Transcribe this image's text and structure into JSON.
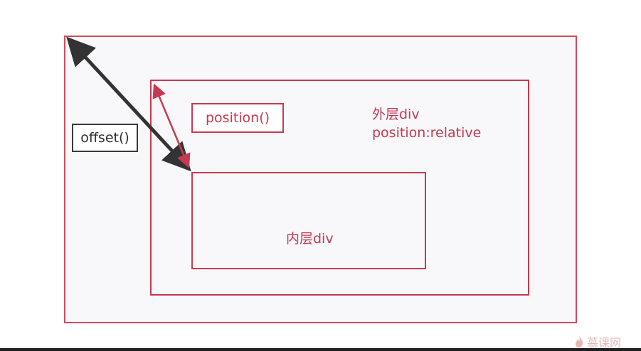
{
  "labels": {
    "offset": "offset()",
    "position": "position()",
    "outer_div_title": "外层div",
    "outer_div_style": "position:relative",
    "inner_div_title": "内层div"
  },
  "watermark": {
    "text": "慕课网"
  },
  "colors": {
    "red": "#c8394f",
    "outer_border": "#d24b5f",
    "dark_arrow": "#333333",
    "box_fill": "#f8f8fb"
  },
  "icons": {
    "watermark_logo": "flame-icon"
  }
}
